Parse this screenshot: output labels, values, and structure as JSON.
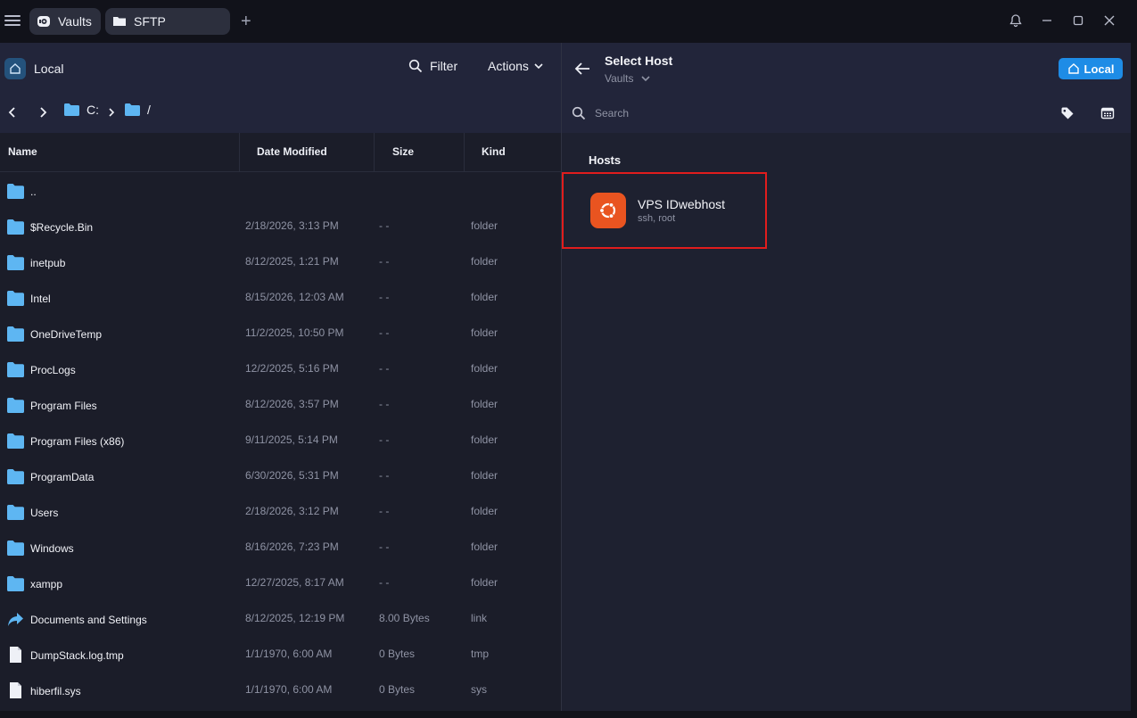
{
  "titlebar": {
    "tabs": [
      {
        "label": "Vaults",
        "icon": "vault-icon"
      },
      {
        "label": "SFTP",
        "icon": "folder-icon"
      }
    ],
    "add_tab": "+"
  },
  "left": {
    "location_label": "Local",
    "filter_label": "Filter",
    "actions_label": "Actions",
    "path": [
      "C:",
      "/"
    ],
    "columns": [
      "Name",
      "Date Modified",
      "Size",
      "Kind"
    ],
    "files": [
      {
        "name": "..",
        "date": "",
        "size": "",
        "kind": "",
        "icon": "folder-icon"
      },
      {
        "name": "$Recycle.Bin",
        "date": "2/18/2026, 3:13 PM",
        "size": "- -",
        "kind": "folder",
        "icon": "folder-icon"
      },
      {
        "name": "inetpub",
        "date": "8/12/2025, 1:21 PM",
        "size": "- -",
        "kind": "folder",
        "icon": "folder-icon"
      },
      {
        "name": "Intel",
        "date": "8/15/2026, 12:03 AM",
        "size": "- -",
        "kind": "folder",
        "icon": "folder-icon"
      },
      {
        "name": "OneDriveTemp",
        "date": "11/2/2025, 10:50 PM",
        "size": "- -",
        "kind": "folder",
        "icon": "folder-icon"
      },
      {
        "name": "ProcLogs",
        "date": "12/2/2025, 5:16 PM",
        "size": "- -",
        "kind": "folder",
        "icon": "folder-icon"
      },
      {
        "name": "Program Files",
        "date": "8/12/2026, 3:57 PM",
        "size": "- -",
        "kind": "folder",
        "icon": "folder-icon"
      },
      {
        "name": "Program Files (x86)",
        "date": "9/11/2025, 5:14 PM",
        "size": "- -",
        "kind": "folder",
        "icon": "folder-icon"
      },
      {
        "name": "ProgramData",
        "date": "6/30/2026, 5:31 PM",
        "size": "- -",
        "kind": "folder",
        "icon": "folder-icon"
      },
      {
        "name": "Users",
        "date": "2/18/2026, 3:12 PM",
        "size": "- -",
        "kind": "folder",
        "icon": "folder-icon"
      },
      {
        "name": "Windows",
        "date": "8/16/2026, 7:23 PM",
        "size": "- -",
        "kind": "folder",
        "icon": "folder-icon"
      },
      {
        "name": "xampp",
        "date": "12/27/2025, 8:17 AM",
        "size": "- -",
        "kind": "folder",
        "icon": "folder-icon"
      },
      {
        "name": "Documents and Settings",
        "date": "8/12/2025, 12:19 PM",
        "size": "8.00 Bytes",
        "kind": "link",
        "icon": "link-icon"
      },
      {
        "name": "DumpStack.log.tmp",
        "date": "1/1/1970, 6:00 AM",
        "size": "0 Bytes",
        "kind": "tmp",
        "icon": "file-icon"
      },
      {
        "name": "hiberfil.sys",
        "date": "1/1/1970, 6:00 AM",
        "size": "0 Bytes",
        "kind": "sys",
        "icon": "file-icon"
      }
    ]
  },
  "right": {
    "title": "Select Host",
    "subtitle": "Vaults",
    "local_button": "Local",
    "search_placeholder": "Search",
    "hosts_heading": "Hosts",
    "hosts": [
      {
        "name": "VPS IDwebhost",
        "meta": "ssh, root",
        "icon": "ubuntu-icon"
      }
    ]
  },
  "colors": {
    "accent": "#1e8ce6",
    "folder": "#5eb6f2",
    "ubuntu": "#e95420",
    "highlight": "#e11d1d"
  }
}
